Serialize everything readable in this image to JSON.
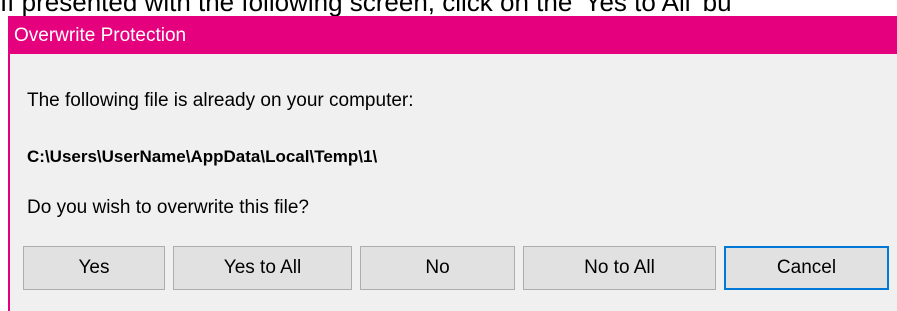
{
  "background_caption": "If presented with the following screen, click on the 'Yes to All' bu",
  "dialog": {
    "title": "Overwrite Protection",
    "message": "The following file is already on your computer:",
    "file_path": "C:\\Users\\UserName\\AppData\\Local\\Temp\\1\\",
    "question": "Do you wish to overwrite this file?"
  },
  "buttons": {
    "yes": "Yes",
    "yes_to_all": "Yes to All",
    "no": "No",
    "no_to_all": "No to All",
    "cancel": "Cancel"
  },
  "colors": {
    "title_bar": "#e5007e",
    "dialog_bg": "#f0f0f0",
    "button_bg": "#e1e1e1",
    "focus_border": "#0078d7"
  }
}
